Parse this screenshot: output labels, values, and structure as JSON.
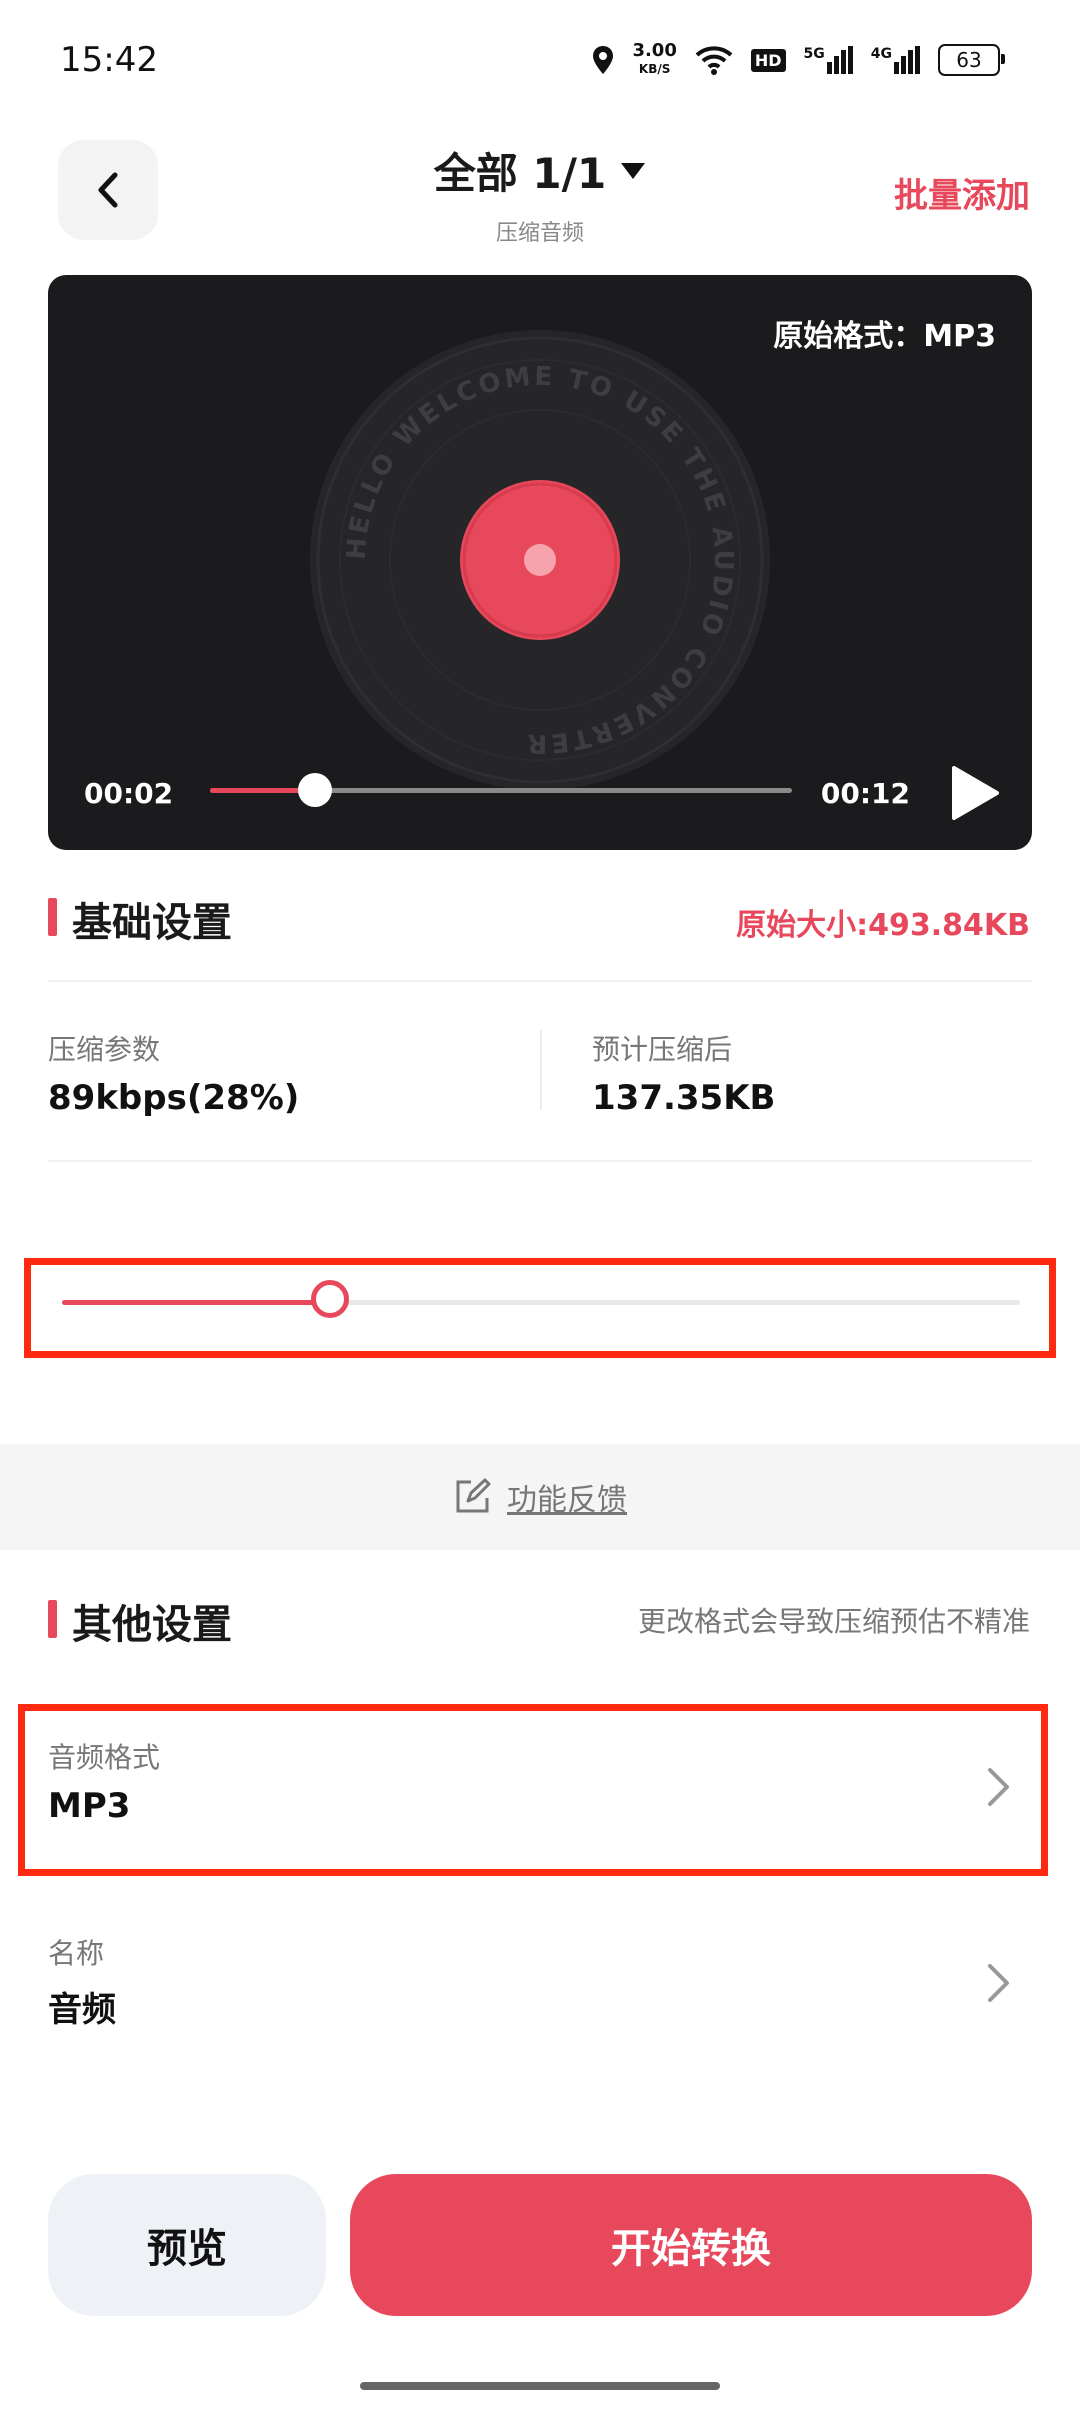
{
  "status_bar": {
    "time": "15:42",
    "net_speed_value": "3.00",
    "net_speed_unit": "KB/S",
    "hd_badge": "HD",
    "sig1_label": "5G",
    "sig2_label": "4G",
    "battery": "63"
  },
  "header": {
    "title": "全部 1/1",
    "subtitle": "压缩音频",
    "batch_add": "批量添加"
  },
  "player": {
    "original_format": "原始格式：MP3",
    "disc_text": "HELLO WELCOME TO USE THE AUDIO CONVERTER",
    "current_time": "00:02",
    "total_time": "00:12",
    "progress": 0.18
  },
  "basic_settings": {
    "title": "基础设置",
    "original_size": "原始大小:493.84KB",
    "compress_param_label": "压缩参数",
    "compress_param_value": "89kbps(28%)",
    "estimated_label": "预计压缩后",
    "estimated_value": "137.35KB",
    "slider_value": 0.28
  },
  "feedback": {
    "label": "功能反馈"
  },
  "other_settings": {
    "title": "其他设置",
    "note": "更改格式会导致压缩预估不精准",
    "format_label": "音频格式",
    "format_value": "MP3",
    "name_label": "名称",
    "name_value": "音频"
  },
  "actions": {
    "preview": "预览",
    "start": "开始转换"
  },
  "colors": {
    "accent": "#e8485b",
    "highlight_box": "#ff2a10"
  }
}
